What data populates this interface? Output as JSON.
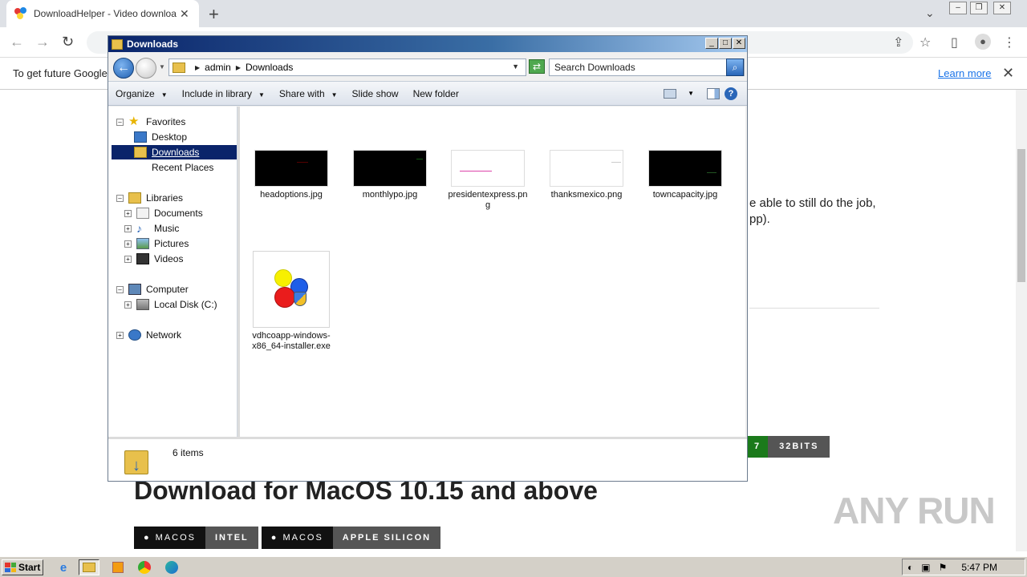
{
  "browser": {
    "tab_title": "DownloadHelper - Video download b",
    "tab_close": "✕",
    "new_tab": "+",
    "infobar_text": "To get future Google",
    "infobar_link": "Learn more",
    "infobar_close": "✕"
  },
  "page": {
    "body_text_line1": "e able to still do the job,",
    "body_text_line2": "pp).",
    "badge_partial": "7",
    "badge_bits": "32BITS",
    "macos_heading": "Download for MacOS 10.15 and above",
    "mac_buttons": [
      {
        "os_label": "MACOS",
        "arch_label": "INTEL"
      },
      {
        "os_label": "MACOS",
        "arch_label": "APPLE SILICON"
      }
    ],
    "watermark": "ANY RUN"
  },
  "explorer": {
    "title": "Downloads",
    "breadcrumb": [
      "admin",
      "Downloads"
    ],
    "search_placeholder": "Search Downloads",
    "commands": [
      "Organize",
      "Include in library",
      "Share with",
      "Slide show",
      "New folder"
    ],
    "nav": {
      "favorites": "Favorites",
      "desktop": "Desktop",
      "downloads": "Downloads",
      "recent_places": "Recent Places",
      "libraries": "Libraries",
      "documents": "Documents",
      "music": "Music",
      "pictures": "Pictures",
      "videos": "Videos",
      "computer": "Computer",
      "local_disk": "Local Disk (C:)",
      "network": "Network"
    },
    "files": [
      {
        "name": "headoptions.jpg",
        "thumb": "black"
      },
      {
        "name": "monthlypo.jpg",
        "thumb": "black"
      },
      {
        "name": "presidentexpress.png",
        "thumb": "white"
      },
      {
        "name": "thanksmexico.png",
        "thumb": "white"
      },
      {
        "name": "towncapacity.jpg",
        "thumb": "black"
      },
      {
        "name": "vdhcoapp-windows-x86_64-installer.exe",
        "thumb": "installer-icon"
      }
    ],
    "status": "6 items"
  },
  "taskbar": {
    "start_label": "Start",
    "clock": "5:47 PM"
  }
}
